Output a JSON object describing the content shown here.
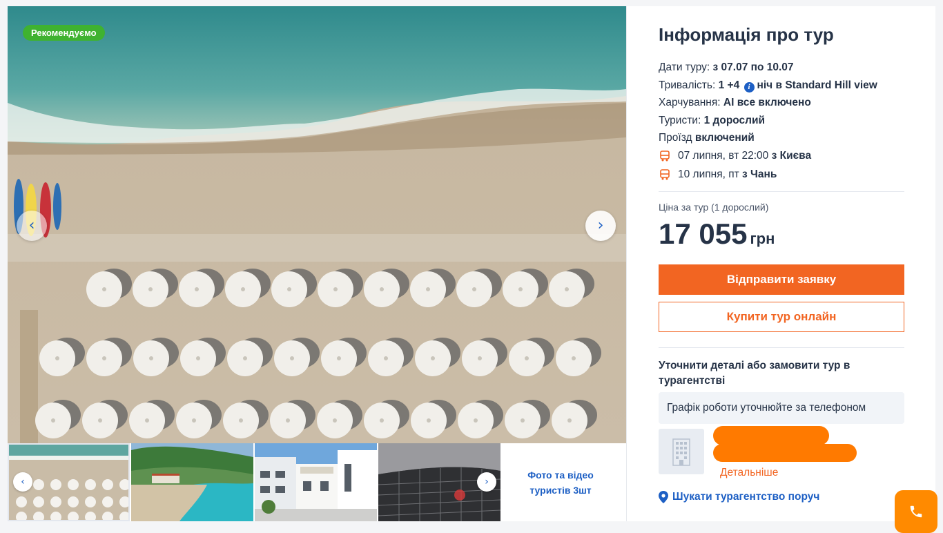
{
  "gallery": {
    "badge": "Рекомендуємо",
    "prev_icon": "‹",
    "next_icon": "›",
    "more_media": "Фото та відео туристів 3шт"
  },
  "panel": {
    "title": "Інформація про тур",
    "dates_label": "Дати туру:",
    "dates_value": "з 07.07 по 10.07",
    "duration_label": "Тривалість:",
    "duration_value": "1 +4",
    "duration_rest": "ніч в Standard Hill view",
    "meals_label": "Харчування:",
    "meals_value": "AI все включено",
    "tourists_label": "Туристи:",
    "tourists_value": "1 дорослий",
    "transfer_label": "Проїзд",
    "transfer_value": "включений",
    "depart_date": "07 липня, вт 22:00",
    "depart_city": "з Києва",
    "return_date": "10 липня, пт",
    "return_city": "з Чань",
    "price_label": "Ціна за тур (1 дорослий)",
    "price_value": "17 055",
    "price_currency": "грн",
    "send_request": "Відправити заявку",
    "buy_online": "Купити тур онлайн",
    "agency_title": "Уточнити деталі або замовити тур в турагентстві",
    "schedule": "Графік роботи уточнюйте за телефоном",
    "details_link": "Детальніше",
    "find_agency": "Шукати турагентство поруч"
  },
  "colors": {
    "accent": "#f26522",
    "link": "#1d5fc4",
    "badge": "#3fb230",
    "call": "#ff8a00"
  },
  "icons": [
    "info-icon",
    "bus-icon",
    "location-pin-icon",
    "phone-icon",
    "building-icon",
    "chevron-left-icon",
    "chevron-right-icon"
  ]
}
